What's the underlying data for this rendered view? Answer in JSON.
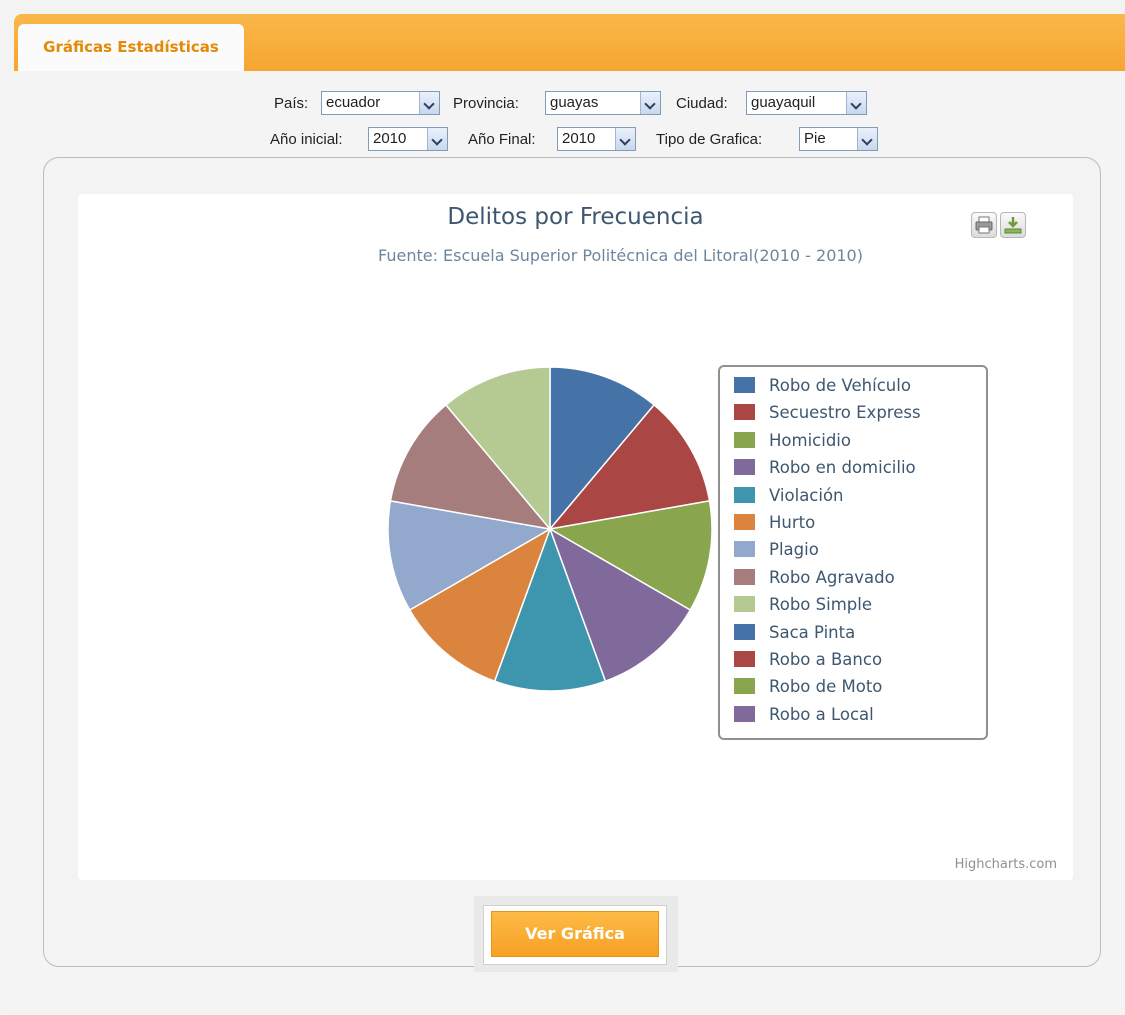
{
  "tab": {
    "label": "Gráficas Estadísticas"
  },
  "filters": {
    "pais": {
      "label": "País:",
      "value": "ecuador"
    },
    "provincia": {
      "label": "Provincia:",
      "value": "guayas"
    },
    "ciudad": {
      "label": "Ciudad:",
      "value": "guayaquil"
    },
    "anio_inicial": {
      "label": "Año inicial:",
      "value": "2010"
    },
    "anio_final": {
      "label": "Año Final:",
      "value": "2010"
    },
    "tipo_grafica": {
      "label": "Tipo de Grafica:",
      "value": "Pie"
    }
  },
  "toolbar": {
    "print_icon": "printer-icon",
    "export_icon": "download-icon"
  },
  "credits": "Highcharts.com",
  "button": {
    "label": "Ver Gráfica"
  },
  "chart_data": {
    "type": "pie",
    "title": "Delitos por Frecuencia",
    "subtitle": "Fuente: Escuela Superior Politécnica del Litoral(2010 - 2010)",
    "legend_position": "right",
    "slices": [
      {
        "label": "Robo de Vehículo",
        "value": 1,
        "color": "#4572a7"
      },
      {
        "label": "Secuestro Express",
        "value": 1,
        "color": "#aa4643"
      },
      {
        "label": "Homicidio",
        "value": 1,
        "color": "#89a54e"
      },
      {
        "label": "Robo en domicilio",
        "value": 1,
        "color": "#80699b"
      },
      {
        "label": "Violación",
        "value": 1,
        "color": "#3d96ae"
      },
      {
        "label": "Hurto",
        "value": 1,
        "color": "#db843d"
      },
      {
        "label": "Plagio",
        "value": 1,
        "color": "#92a8cd"
      },
      {
        "label": "Robo Agravado",
        "value": 1,
        "color": "#a47d7c"
      },
      {
        "label": "Robo Simple",
        "value": 1,
        "color": "#b5ca92"
      },
      {
        "label": "Saca Pinta",
        "value": 0,
        "color": "#4572a7"
      },
      {
        "label": "Robo a Banco",
        "value": 0,
        "color": "#aa4643"
      },
      {
        "label": "Robo de Moto",
        "value": 0,
        "color": "#89a54e"
      },
      {
        "label": "Robo a Local",
        "value": 0,
        "color": "#80699b"
      }
    ]
  }
}
